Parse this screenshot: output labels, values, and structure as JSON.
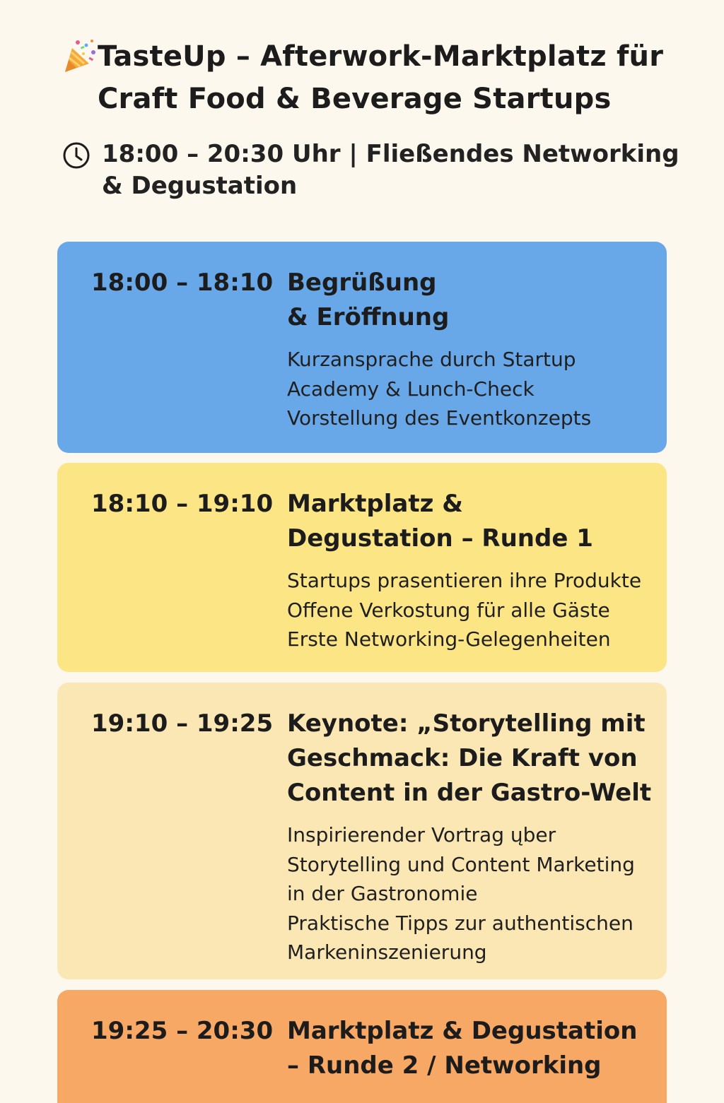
{
  "header": {
    "title_line1": "TasteUp – Afterwork-Marktplatz für",
    "title_line2": "Craft Food & Beverage Startups",
    "subtitle_line1": "18:00 – 20:30 Uhr | Fließendes Networking",
    "subtitle_line2": "& Degustation",
    "icons": [
      "party-popper-icon",
      "clock-icon"
    ]
  },
  "colors": {
    "background": "#fdf8ee",
    "card_1": "#69a8e8",
    "card_2": "#fce585",
    "card_3": "#fbe7b4",
    "card_4": "#f6a864"
  },
  "agenda": [
    {
      "time": "18:00 – 18:10",
      "heading": [
        "Begrüßung",
        "& Eröffnung"
      ],
      "details": [
        "Kurzansprache durch Startup",
        "Academy & Lunch-Check",
        "Vorstellung des Eventkonzepts"
      ]
    },
    {
      "time": "18:10 – 19:10",
      "heading": [
        "Marktplatz &",
        "Degustation – Runde 1"
      ],
      "details": [
        "Startups prasentieren ihre Produkte",
        "Offene Verkostung für alle Gäste",
        "Erste Networking-Gelegenheiten"
      ]
    },
    {
      "time": "19:10 – 19:25",
      "heading": [
        "Keynote: „Storytelling mit",
        "Geschmack: Die Kraft von",
        "Content in der Gastro-Welt"
      ],
      "details": [
        "Inspirierender Vortrag ųber",
        "Storytelling und Content Marketing",
        "in der Gastronomie",
        "Praktische Tipps zur authentischen",
        "Markeninszenierung"
      ]
    },
    {
      "time": "19:25 – 20:30",
      "heading": [
        "Marktplatz & Degustation",
        "– Runde 2 / Networking"
      ],
      "details": []
    }
  ]
}
